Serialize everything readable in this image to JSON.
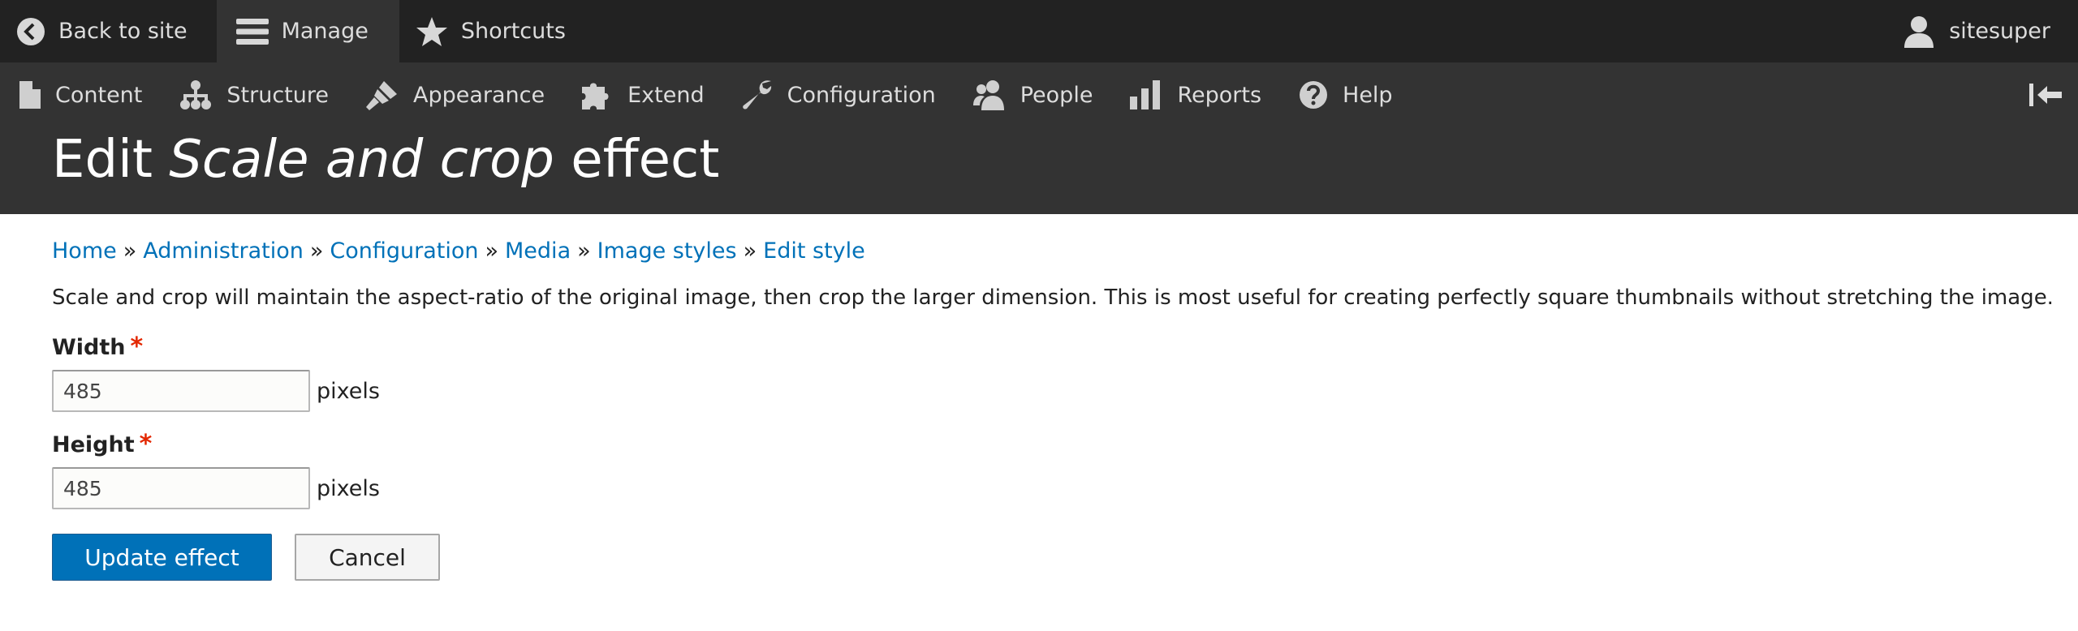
{
  "toolbar": {
    "back_label": "Back to site",
    "manage_label": "Manage",
    "shortcuts_label": "Shortcuts",
    "user_label": "sitesuper"
  },
  "admin_menu": {
    "items": [
      {
        "label": "Content",
        "icon": "file-icon"
      },
      {
        "label": "Structure",
        "icon": "sitemap-icon"
      },
      {
        "label": "Appearance",
        "icon": "paintbrush-icon"
      },
      {
        "label": "Extend",
        "icon": "puzzle-icon"
      },
      {
        "label": "Configuration",
        "icon": "wrench-icon"
      },
      {
        "label": "People",
        "icon": "people-icon"
      },
      {
        "label": "Reports",
        "icon": "bar-chart-icon"
      },
      {
        "label": "Help",
        "icon": "help-icon"
      }
    ]
  },
  "page": {
    "title_prefix": "Edit ",
    "title_em": "Scale and crop",
    "title_suffix": " effect"
  },
  "breadcrumb": {
    "items": [
      "Home",
      "Administration",
      "Configuration",
      "Media",
      "Image styles",
      "Edit style"
    ],
    "separator": "»"
  },
  "description": "Scale and crop will maintain the aspect-ratio of the original image, then crop the larger dimension. This is most useful for creating perfectly square thumbnails without stretching the image.",
  "form": {
    "width": {
      "label": "Width",
      "required_mark": "*",
      "value": "485",
      "unit": "pixels"
    },
    "height": {
      "label": "Height",
      "required_mark": "*",
      "value": "485",
      "unit": "pixels"
    },
    "submit_label": "Update effect",
    "cancel_label": "Cancel"
  },
  "colors": {
    "toolbar_bg": "#222222",
    "admin_bg": "#333333",
    "link": "#0071b8",
    "primary_button": "#0071b8",
    "required": "#e32700"
  }
}
